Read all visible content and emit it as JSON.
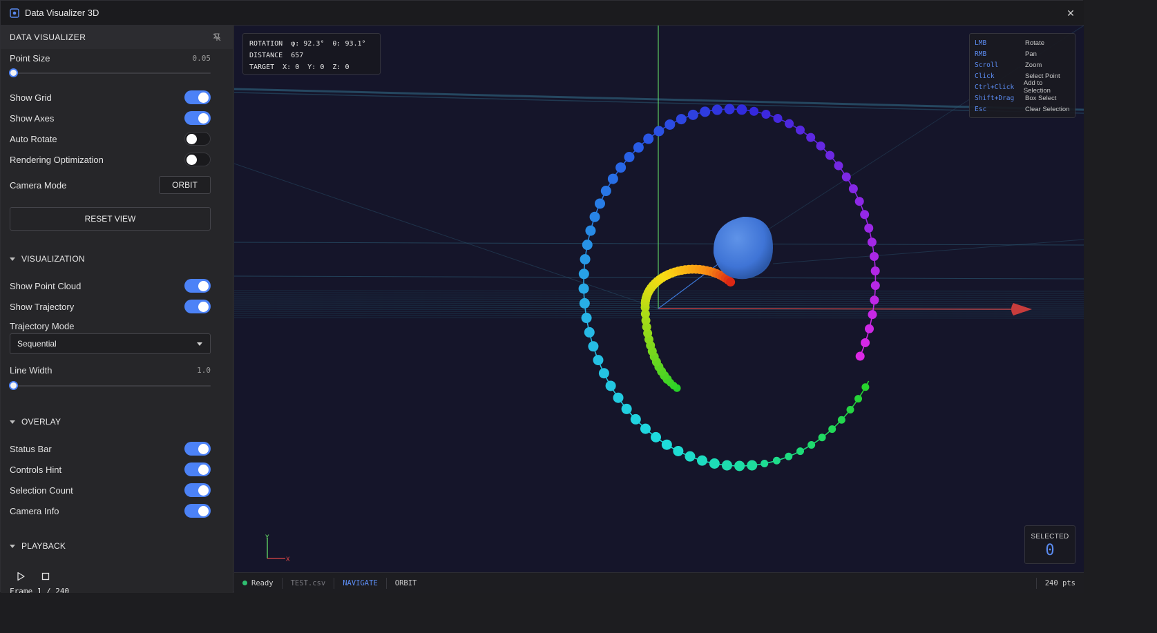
{
  "window": {
    "title": "Data Visualizer 3D"
  },
  "sidebar": {
    "header": "DATA VISUALIZER",
    "point_size": {
      "label": "Point Size",
      "value": "0.05",
      "level": 0.0
    },
    "toggles_top": [
      {
        "label": "Show Grid",
        "on": true
      },
      {
        "label": "Show Axes",
        "on": true
      },
      {
        "label": "Auto Rotate",
        "on": false
      },
      {
        "label": "Rendering Optimization",
        "on": false
      }
    ],
    "camera_mode": {
      "label": "Camera Mode",
      "value": "ORBIT"
    },
    "reset_view": "RESET VIEW",
    "visualization": {
      "title": "VISUALIZATION",
      "show_point_cloud": {
        "label": "Show Point Cloud",
        "on": true
      },
      "show_trajectory": {
        "label": "Show Trajectory",
        "on": true
      },
      "trajectory_mode": {
        "label": "Trajectory Mode",
        "value": "Sequential"
      },
      "line_width": {
        "label": "Line Width",
        "value": "1.0",
        "level": 0.0
      }
    },
    "overlay": {
      "title": "OVERLAY",
      "toggles": [
        {
          "label": "Status Bar",
          "on": true
        },
        {
          "label": "Controls Hint",
          "on": true
        },
        {
          "label": "Selection Count",
          "on": true
        },
        {
          "label": "Camera Info",
          "on": true
        }
      ]
    },
    "playback": {
      "title": "PLAYBACK",
      "frame": "Frame 1 / 240"
    }
  },
  "camera_info": {
    "rotation": "ROTATION  φ: 92.3°  θ: 93.1°",
    "distance": "DISTANCE  657",
    "target": "TARGET  X: 0  Y: 0  Z: 0"
  },
  "controls_hint": [
    {
      "key": "LMB",
      "action": "Rotate"
    },
    {
      "key": "RMB",
      "action": "Pan"
    },
    {
      "key": "Scroll",
      "action": "Zoom"
    },
    {
      "key": "Click",
      "action": "Select Point"
    },
    {
      "key": "Ctrl+Click",
      "action": "Add to Selection"
    },
    {
      "key": "Shift+Drag",
      "action": "Box Select"
    },
    {
      "key": "Esc",
      "action": "Clear Selection"
    }
  ],
  "selected": {
    "label": "SELECTED",
    "count": "0"
  },
  "axis_gizmo": {
    "y": "Y",
    "x": "X"
  },
  "statusbar": {
    "status": "Ready",
    "file": "TEST.csv",
    "mode": "NAVIGATE",
    "camera": "ORBIT",
    "points": "240 pts"
  },
  "colors": {
    "accent": "#4c82f7",
    "background": "#15152a",
    "ready": "#2fbf71"
  }
}
